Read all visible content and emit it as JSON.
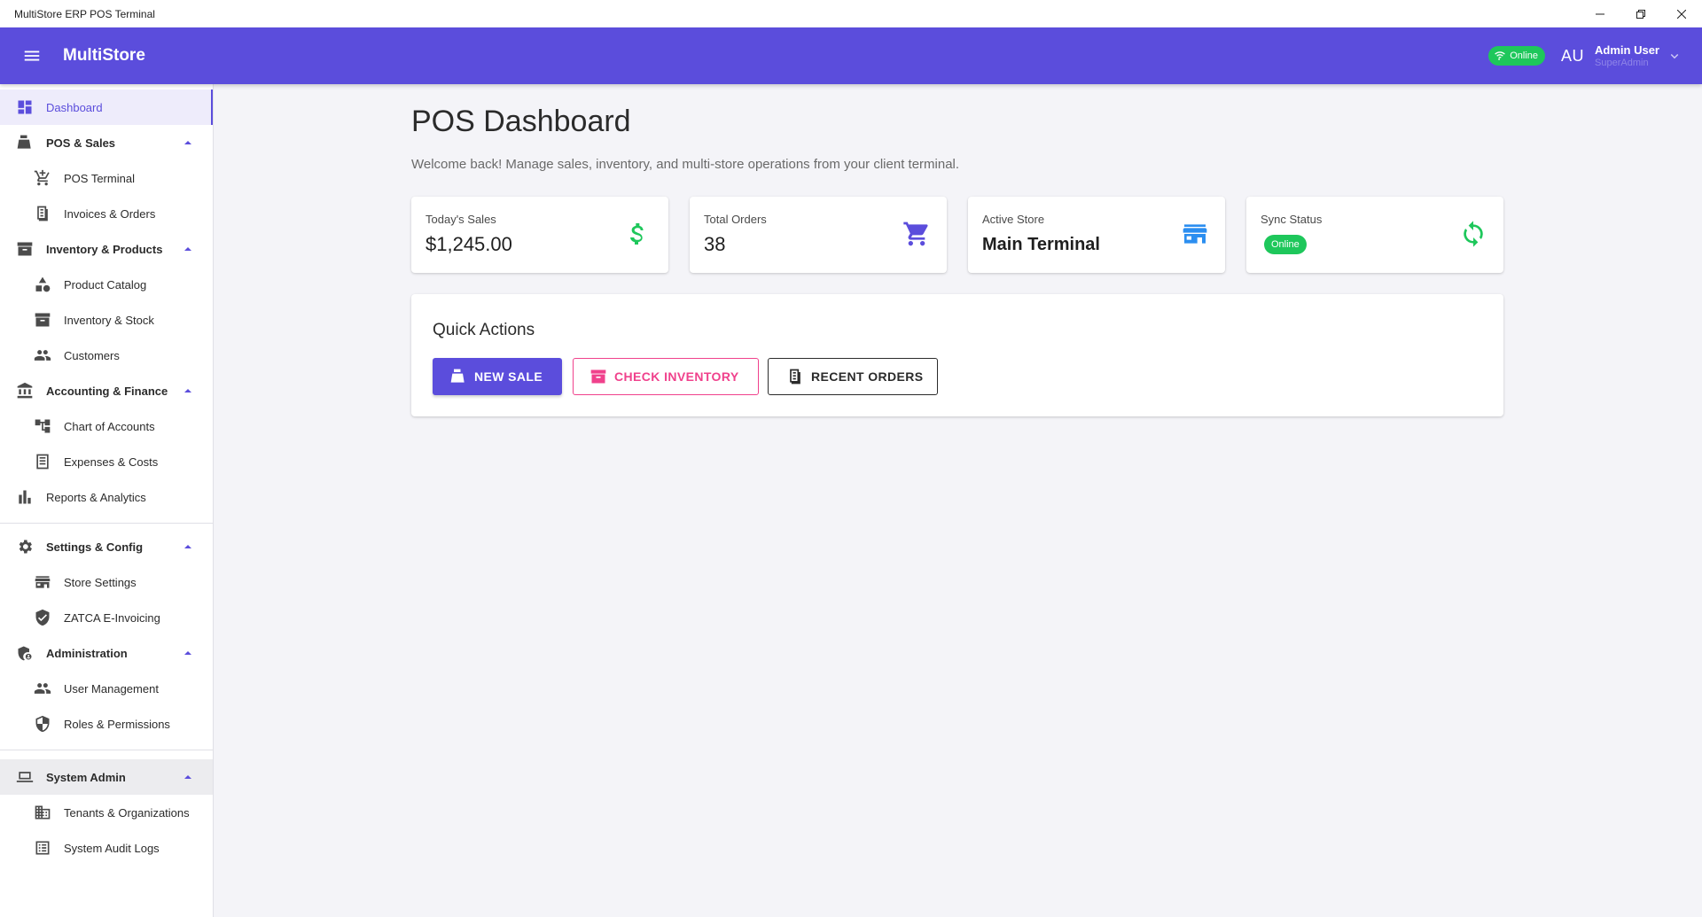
{
  "window": {
    "title": "MultiStore ERP POS Terminal",
    "controls": [
      "minimize-icon",
      "restore-icon",
      "close-icon"
    ]
  },
  "appbar": {
    "brand": "MultiStore",
    "status_chip": "Online",
    "avatar_initials": "AU",
    "user_name": "Admin User",
    "user_role": "SuperAdmin",
    "colors": {
      "background": "#5b4ddc",
      "online": "#1ec75b"
    }
  },
  "sidebar": {
    "dashboard": "Dashboard",
    "pos_sales": "POS & Sales",
    "pos_terminal": "POS Terminal",
    "invoices_orders": "Invoices & Orders",
    "inventory_products": "Inventory & Products",
    "product_catalog": "Product Catalog",
    "inventory_stock": "Inventory & Stock",
    "customers": "Customers",
    "accounting_finance": "Accounting & Finance",
    "chart_of_accounts": "Chart of Accounts",
    "expenses_costs": "Expenses & Costs",
    "reports_analytics": "Reports & Analytics",
    "settings_config": "Settings & Config",
    "store_settings": "Store Settings",
    "zatca": "ZATCA E-Invoicing",
    "administration": "Administration",
    "user_management": "User Management",
    "roles_permissions": "Roles & Permissions",
    "system_admin": "System Admin",
    "tenants_orgs": "Tenants & Organizations",
    "audit_logs": "System Audit Logs"
  },
  "main": {
    "title": "POS Dashboard",
    "subtitle": "Welcome back! Manage sales, inventory, and multi-store operations from your client terminal.",
    "stats": {
      "sales": {
        "label": "Today's Sales",
        "value": "$1,245.00",
        "icon": "dollar-icon",
        "color": "#1ec75b"
      },
      "orders": {
        "label": "Total Orders",
        "value": "38",
        "icon": "cart-icon",
        "color": "#5b4ddc"
      },
      "store": {
        "label": "Active Store",
        "value": "Main Terminal",
        "icon": "storefront-icon",
        "color": "#2b8ef0"
      },
      "sync": {
        "label": "Sync Status",
        "value": "Online",
        "icon": "sync-icon",
        "color": "#1ec75b"
      }
    },
    "quick_actions": {
      "title": "Quick Actions",
      "new_sale": "NEW SALE",
      "check_inventory": "CHECK INVENTORY",
      "recent_orders": "RECENT ORDERS"
    }
  }
}
